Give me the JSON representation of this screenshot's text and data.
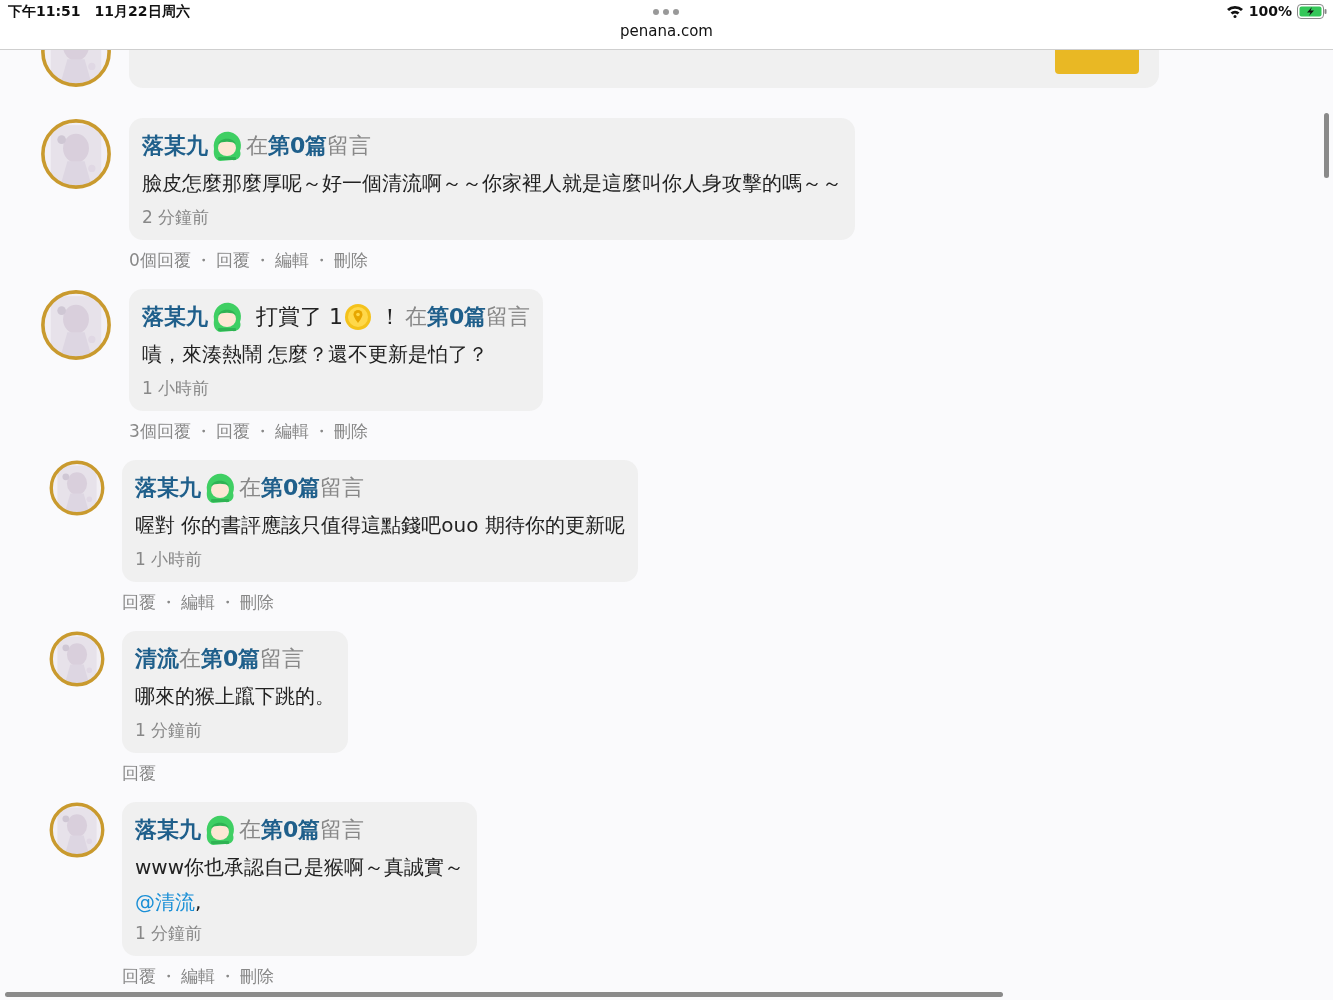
{
  "status_bar": {
    "time": "下午11:51",
    "date": "11月22日周六",
    "url": "penana.com",
    "battery": "100%"
  },
  "comment_box": {
    "avatar": {
      "kind": "picture"
    }
  },
  "comments": [
    {
      "avatar": {
        "kind": "picture"
      },
      "author": "落某九",
      "sticker": true,
      "prefix": "在",
      "chapter": "第0篇",
      "suffix": "留言",
      "body": "臉皮怎麼那麼厚呢～好一個清流啊～～你家裡人就是這麼叫你人身攻擊的嗎～～",
      "time": "2 分鐘前",
      "actions": [
        {
          "kind": "link",
          "text": "0個回覆"
        },
        {
          "kind": "separator",
          "text": "・"
        },
        {
          "kind": "link",
          "text": "回覆"
        },
        {
          "kind": "separator",
          "text": "・"
        },
        {
          "kind": "link",
          "text": "編輯"
        },
        {
          "kind": "separator",
          "text": "・"
        },
        {
          "kind": "link",
          "text": "刪除"
        }
      ]
    },
    {
      "avatar": {
        "kind": "picture"
      },
      "author": "落某九",
      "sticker": true,
      "tip": {
        "label": "打賞了 1",
        "exclaim": "！"
      },
      "prefix": "在",
      "chapter": "第0篇",
      "suffix": "留言",
      "body": "嘖，來湊熱鬧 怎麼？還不更新是怕了？",
      "time": "1 小時前",
      "actions": [
        {
          "kind": "link",
          "text": "3個回覆"
        },
        {
          "kind": "separator",
          "text": "・"
        },
        {
          "kind": "link",
          "text": "回覆"
        },
        {
          "kind": "separator",
          "text": "・"
        },
        {
          "kind": "link",
          "text": "編輯"
        },
        {
          "kind": "separator",
          "text": "・"
        },
        {
          "kind": "link",
          "text": "刪除"
        }
      ],
      "replies": [
        {
          "avatar": {
            "kind": "picture"
          },
          "author": "落某九",
          "sticker": true,
          "prefix": "在",
          "chapter": "第0篇",
          "suffix": "留言",
          "body": "喔對 你的書評應該只值得這點錢吧ouo 期待你的更新呢",
          "time": "1 小時前",
          "actions": [
            {
              "kind": "link",
              "text": "回覆"
            },
            {
              "kind": "separator",
              "text": "・"
            },
            {
              "kind": "link",
              "text": "編輯"
            },
            {
              "kind": "separator",
              "text": "・"
            },
            {
              "kind": "link",
              "text": "刪除"
            }
          ]
        },
        {
          "avatar": {
            "kind": "picture"
          },
          "author": "清流",
          "sticker": false,
          "prefix": "在",
          "chapter": "第0篇",
          "suffix": "留言",
          "body": "哪來的猴上躥下跳的。",
          "time": "1 分鐘前",
          "actions": [
            {
              "kind": "link",
              "text": "回覆"
            }
          ]
        },
        {
          "avatar": {
            "kind": "picture"
          },
          "author": "落某九",
          "sticker": true,
          "prefix": "在",
          "chapter": "第0篇",
          "suffix": "留言",
          "body": "www你也承認自己是猴啊～真誠實～",
          "mention": "@清流",
          "mention_after": ",",
          "time": "1 分鐘前",
          "actions": [
            {
              "kind": "link",
              "text": "回覆"
            },
            {
              "kind": "separator",
              "text": "・"
            },
            {
              "kind": "link",
              "text": "編輯"
            },
            {
              "kind": "separator",
              "text": "・"
            },
            {
              "kind": "link",
              "text": "刪除"
            }
          ]
        }
      ]
    }
  ]
}
